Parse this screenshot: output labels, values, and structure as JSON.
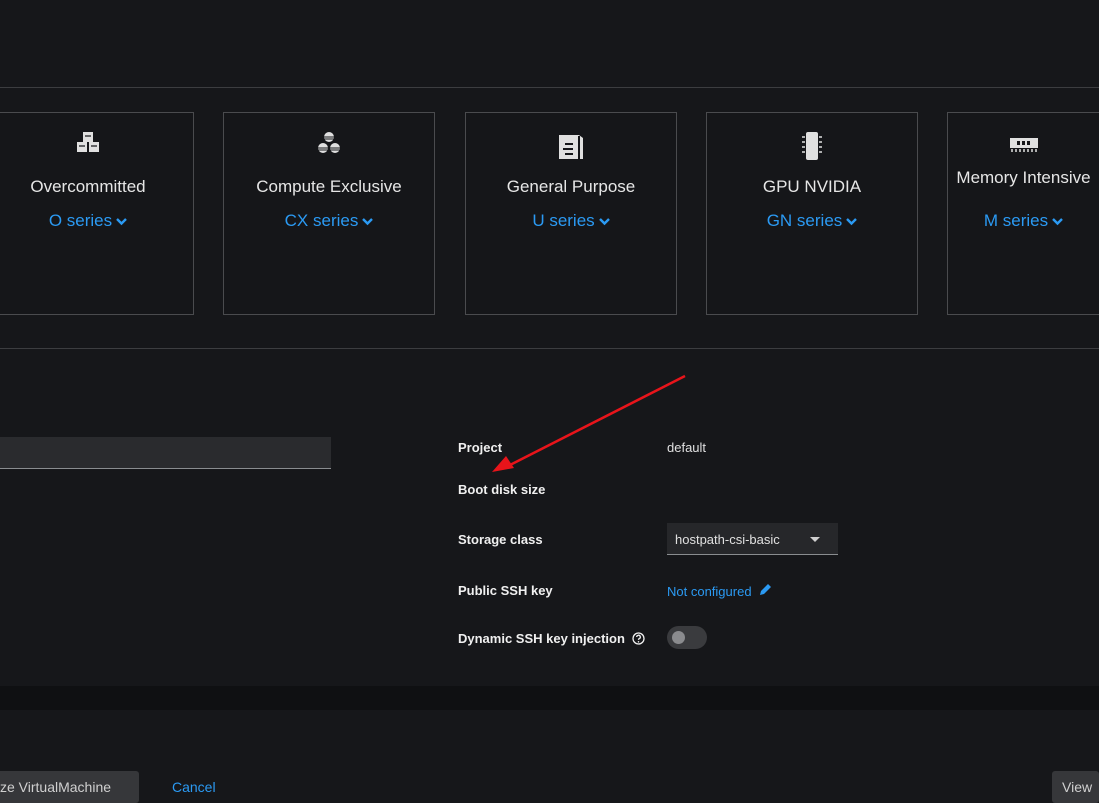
{
  "cards": [
    {
      "title": "Overcommitted",
      "series": "O series",
      "icon": "cubes-icon"
    },
    {
      "title": "Compute Exclusive",
      "series": "CX series",
      "icon": "stacked-cubes-icon"
    },
    {
      "title": "General Purpose",
      "series": "U series",
      "icon": "server-box-icon"
    },
    {
      "title": "GPU NVIDIA",
      "series": "GN series",
      "icon": "chip-icon"
    },
    {
      "title": "Memory Intensive",
      "series": "M series",
      "icon": "memory-icon"
    }
  ],
  "details": {
    "project_label": "Project",
    "project_value": "default",
    "boot_disk_label": "Boot disk size",
    "storage_class_label": "Storage class",
    "storage_class_value": "hostpath-csi-basic",
    "ssh_key_label": "Public SSH key",
    "ssh_key_value": "Not configured",
    "dynamic_ssh_label": "Dynamic SSH key injection",
    "dynamic_ssh_enabled": false
  },
  "footer": {
    "create_label": "ze VirtualMachine",
    "cancel_label": "Cancel",
    "view_label": "View"
  },
  "colors": {
    "accent": "#2b9af3",
    "annotation_arrow": "#e8141a"
  }
}
